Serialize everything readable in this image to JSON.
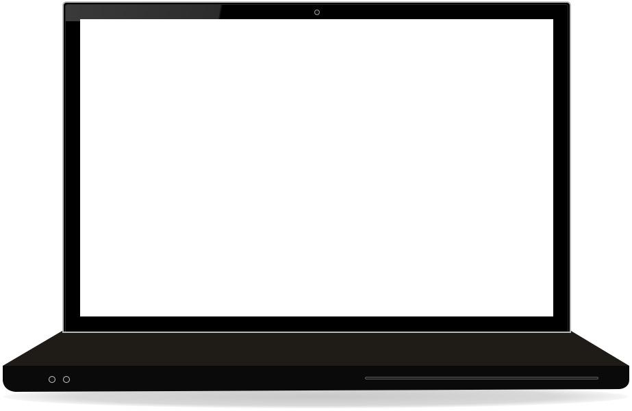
{
  "device": {
    "type": "laptop",
    "view": "front",
    "screen_state": "blank",
    "colors": {
      "body": "#000000",
      "base_top": "#1f1c18",
      "base_front": "#0a0a0a",
      "screen": "#ffffff",
      "bezel_edge": "#b9b9b9"
    }
  }
}
